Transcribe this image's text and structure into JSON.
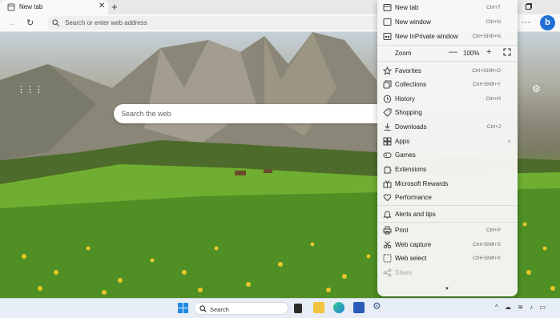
{
  "browser": {
    "tab_title": "New tab",
    "address_placeholder": "Search or enter web address"
  },
  "newtab_page": {
    "search_placeholder": "Search the web"
  },
  "menu": {
    "items": [
      {
        "label": "New tab",
        "shortcut": "Ctrl+T",
        "icon": "new-tab-icon"
      },
      {
        "label": "New window",
        "shortcut": "Ctrl+N",
        "icon": "window-icon"
      },
      {
        "label": "New InPrivate window",
        "shortcut": "Ctrl+Shift+N",
        "icon": "inprivate-icon"
      },
      {
        "label": "Favorites",
        "shortcut": "Ctrl+Shift+O",
        "icon": "star-icon"
      },
      {
        "label": "Collections",
        "shortcut": "Ctrl+Shift+Y",
        "icon": "collections-icon"
      },
      {
        "label": "History",
        "shortcut": "Ctrl+H",
        "icon": "history-icon"
      },
      {
        "label": "Shopping",
        "shortcut": "",
        "icon": "tag-icon"
      },
      {
        "label": "Downloads",
        "shortcut": "Ctrl+J",
        "icon": "download-icon"
      },
      {
        "label": "Apps",
        "shortcut": "",
        "icon": "apps-icon"
      },
      {
        "label": "Games",
        "shortcut": "",
        "icon": "gamepad-icon"
      },
      {
        "label": "Extensions",
        "shortcut": "",
        "icon": "puzzle-icon"
      },
      {
        "label": "Microsoft Rewards",
        "shortcut": "",
        "icon": "rewards-icon"
      },
      {
        "label": "Performance",
        "shortcut": "",
        "icon": "heart-pulse-icon"
      },
      {
        "label": "Alerts and tips",
        "shortcut": "",
        "icon": "bell-icon"
      },
      {
        "label": "Print",
        "shortcut": "Ctrl+P",
        "icon": "printer-icon"
      },
      {
        "label": "Web capture",
        "shortcut": "Ctrl+Shift+S",
        "icon": "scissors-icon"
      },
      {
        "label": "Web select",
        "shortcut": "Ctrl+Shift+X",
        "icon": "select-icon"
      },
      {
        "label": "Share",
        "shortcut": "",
        "icon": "share-icon",
        "disabled": true
      }
    ],
    "zoom": {
      "label": "Zoom",
      "value": "100%",
      "minus": "—",
      "plus": "+"
    }
  },
  "taskbar": {
    "search_label": "Search"
  },
  "colors": {
    "accent": "#1f6fd6",
    "menu_bg": "#f7f7f6",
    "taskbar_bg": "#e7edf5"
  }
}
